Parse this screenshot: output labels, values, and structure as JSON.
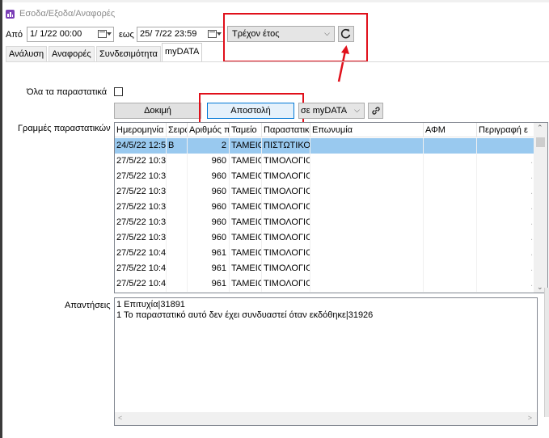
{
  "window": {
    "title": "Εσοδα/Εξοδα/Αναφορές",
    "icon": "chart-report-icon"
  },
  "filters": {
    "from_label": "Από",
    "from_value": "1/ 1/22 00:00",
    "to_label": "εως",
    "to_value": "25/ 7/22 23:59",
    "period_value": "Τρέχον έτος",
    "refresh_icon": "refresh-icon"
  },
  "tabs": [
    {
      "label": "Ανάλυση"
    },
    {
      "label": "Αναφορές"
    },
    {
      "label": "Συνδεσιμότητα"
    },
    {
      "label": "myDATA",
      "active": true
    }
  ],
  "all_docs_label": "Όλα τα παραστατικά",
  "buttons": {
    "test": "Δοκιμή",
    "send": "Αποστολή",
    "target_value": "σε myDATA",
    "link_icon": "link-icon"
  },
  "lines_label": "Γραμμές παραστατικών",
  "grid": {
    "columns": [
      "Ημερομηνία",
      "Σειρά",
      "Αριθμός π",
      "Ταμείο",
      "Παραστατικό",
      "Επωνυμία",
      "ΑΦΜ",
      "Περιγραφή ε"
    ],
    "rows": [
      [
        "24/5/22 12:5",
        "B",
        "2",
        "ΤΑΜΕΙΟ",
        "ΠΙΣΤΩΤΙΚΟ",
        "",
        "",
        ""
      ],
      [
        "27/5/22 10:3",
        "",
        "960",
        "ΤΑΜΕΙΟ",
        "ΤΙΜΟΛΟΓΙΟ",
        "",
        "",
        "."
      ],
      [
        "27/5/22 10:3",
        "",
        "960",
        "ΤΑΜΕΙΟ",
        "ΤΙΜΟΛΟΓΙΟ",
        "",
        "",
        "."
      ],
      [
        "27/5/22 10:3",
        "",
        "960",
        "ΤΑΜΕΙΟ",
        "ΤΙΜΟΛΟΓΙΟ",
        "",
        "",
        "."
      ],
      [
        "27/5/22 10:3",
        "",
        "960",
        "ΤΑΜΕΙΟ",
        "ΤΙΜΟΛΟΓΙΟ",
        "",
        "",
        "."
      ],
      [
        "27/5/22 10:3",
        "",
        "960",
        "ΤΑΜΕΙΟ",
        "ΤΙΜΟΛΟΓΙΟ",
        "",
        "",
        "."
      ],
      [
        "27/5/22 10:3",
        "",
        "960",
        "ΤΑΜΕΙΟ",
        "ΤΙΜΟΛΟΓΙΟ",
        "",
        "",
        "."
      ],
      [
        "27/5/22 10:4",
        "",
        "961",
        "ΤΑΜΕΙΟ",
        "ΤΙΜΟΛΟΓΙΟ",
        "",
        "",
        "."
      ],
      [
        "27/5/22 10:4",
        "",
        "961",
        "ΤΑΜΕΙΟ",
        "ΤΙΜΟΛΟΓΙΟ",
        "",
        "",
        "."
      ],
      [
        "27/5/22 10:4",
        "",
        "961",
        "ΤΑΜΕΙΟ",
        "ΤΙΜΟΛΟΓΙΟ",
        "",
        "",
        "."
      ]
    ]
  },
  "answers_label": "Απαντήσεις",
  "answers_lines": [
    "1 Επιτυχία|31891",
    "1 Το παραστατικό αυτό δεν έχει συνδυαστεί όταν εκδόθηκε|31926"
  ],
  "colors": {
    "highlight": "#e0101b",
    "selection": "#99c9ef",
    "accent": "#0078d7"
  }
}
